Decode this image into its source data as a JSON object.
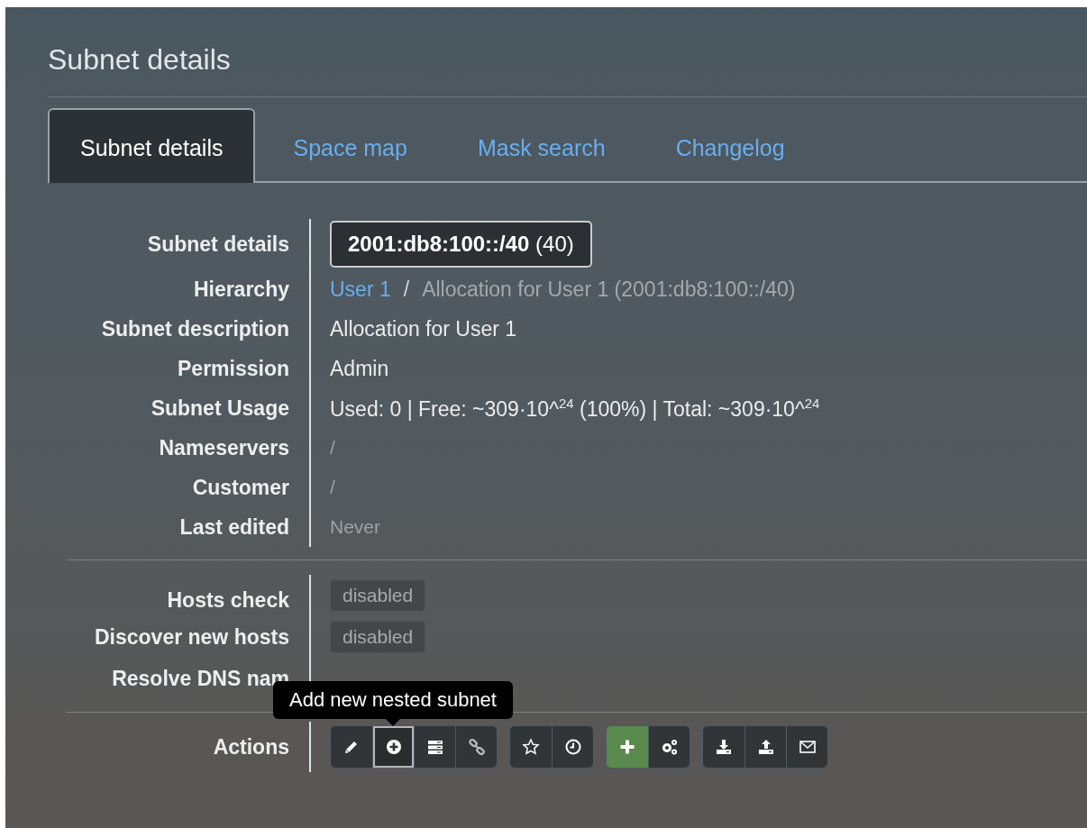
{
  "title": "Subnet details",
  "tabs": [
    {
      "label": "Subnet details",
      "selected": true
    },
    {
      "label": "Space map",
      "selected": false
    },
    {
      "label": "Mask search",
      "selected": false
    },
    {
      "label": "Changelog",
      "selected": false
    }
  ],
  "details": [
    {
      "label": "Subnet details",
      "kind": "badge",
      "value": "**2001:db8:100::/40** (40)"
    },
    {
      "label": "Hierarchy",
      "kind": "path",
      "link": "User 1",
      "separator": "/",
      "value": "Allocation for User 1 (2001:db8:100::/40)"
    },
    {
      "label": "Subnet description",
      "kind": "text",
      "value": "Allocation for User 1",
      "muted": false
    },
    {
      "label": "Permission",
      "kind": "text",
      "value": "Admin",
      "muted": false
    },
    {
      "label": "Subnet Usage",
      "kind": "text",
      "value": "Used: 0 | Free: ~309·10^$^{24}$ (100%) | Total: ~309·10^$^{24}$",
      "muted": false
    },
    {
      "label": "Nameservers",
      "kind": "text",
      "value": "/",
      "muted": true
    },
    {
      "label": "Customer",
      "kind": "text",
      "value": "/",
      "muted": true
    },
    {
      "label": "Last edited",
      "kind": "text",
      "value": "Never",
      "muted": true
    }
  ],
  "scans": [
    {
      "label": "Hosts check",
      "status": "disabled"
    },
    {
      "label": "Discover new hosts",
      "status": "disabled"
    },
    {
      "label": "Resolve DNS nam"
    }
  ],
  "actions": {
    "label": "Actions",
    "groups": [
      {
        "buttons": [
          {
            "active": false,
            "highlighted": false
          },
          {
            "active": true,
            "highlighted": false
          },
          {
            "active": false,
            "highlighted": false
          },
          {
            "active": false,
            "highlighted": false
          }
        ]
      },
      {
        "buttons": [
          {
            "active": false,
            "highlighted": false
          },
          {
            "active": false,
            "highlighted": false
          }
        ]
      },
      {
        "buttons": [
          {
            "active": false,
            "highlighted": true
          },
          {
            "active": false,
            "highlighted": false
          }
        ]
      },
      {
        "buttons": [
          {
            "active": false,
            "highlighted": false
          },
          {
            "active": false,
            "highlighted": false
          },
          {
            "active": false,
            "highlighted": false
          }
        ]
      }
    ],
    "tooltip": "Add new nested subnet"
  }
}
